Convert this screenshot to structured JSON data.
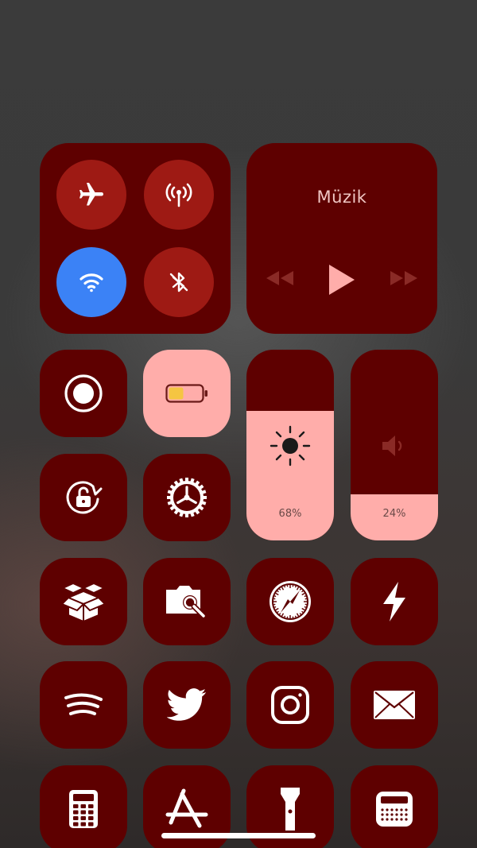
{
  "connectivity": {
    "airplane_icon": "airplane-icon",
    "cellular_icon": "antenna-icon",
    "wifi_icon": "wifi-icon",
    "bluetooth_icon": "bluetooth-off-icon",
    "wifi_on": true
  },
  "music": {
    "title": "Müzik",
    "controls": [
      "rewind-icon",
      "play-icon",
      "fast-forward-icon"
    ]
  },
  "toggles": {
    "screen_record": "record-icon",
    "low_power": "battery-icon",
    "orientation_lock": "rotation-lock-icon",
    "settings": "gear-icon"
  },
  "brightness": {
    "level": 68,
    "label": "68%"
  },
  "volume": {
    "level": 24,
    "label": "24%"
  },
  "apps": [
    [
      "cydia-boxes-icon",
      "camera-folder-icon",
      "compass-icon",
      "lightning-icon"
    ],
    [
      "spotify-icon",
      "twitter-icon",
      "instagram-icon",
      "mail-icon"
    ],
    [
      "calculator-icon",
      "app-store-icon",
      "flashlight-icon",
      "radio-icon"
    ]
  ],
  "colors": {
    "tile": "#5e0000",
    "tile_light": "#ffadaa",
    "round_button": "#9e1a14",
    "wifi_active": "#3b82f6",
    "battery_fill": "#f5c542"
  }
}
